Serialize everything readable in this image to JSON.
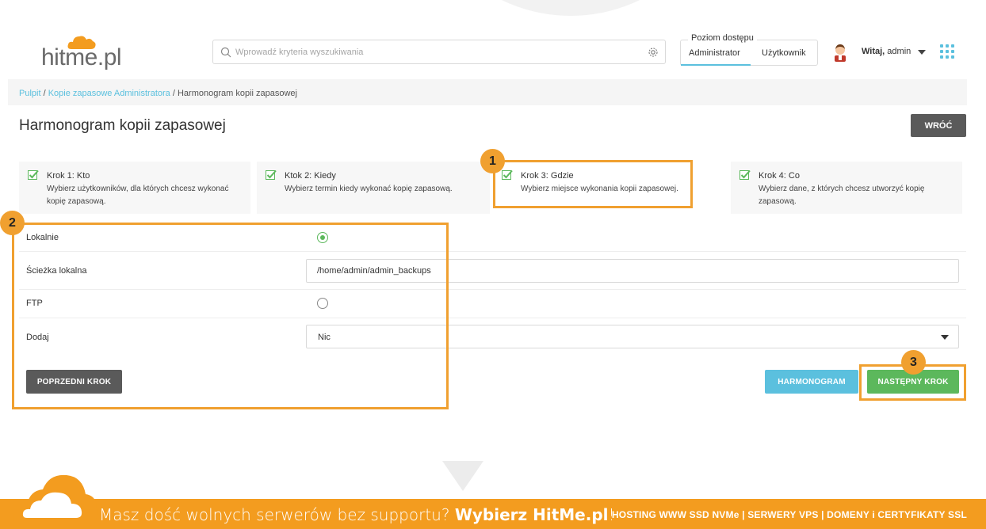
{
  "header": {
    "logo_text": "hitme.pl",
    "search_placeholder": "Wprowadź kryteria wyszukiwania",
    "access": {
      "title": "Poziom dostępu",
      "options": [
        "Administrator",
        "Użytkownik"
      ],
      "selected": "Administrator"
    },
    "greeting_bold": "Witaj,",
    "greeting_user": " admin"
  },
  "breadcrumb": {
    "items": [
      "Pulpit",
      "Kopie zapasowe Administratora",
      "Harmonogram kopii zapasowej"
    ],
    "separator": " / "
  },
  "page": {
    "title": "Harmonogram kopii zapasowej",
    "back_label": "WRÓĆ"
  },
  "steps": [
    {
      "title": "Krok 1: Kto",
      "desc": "Wybierz użytkowników, dla których chcesz wykonać kopię zapasową.",
      "checked": true
    },
    {
      "title": "Ktok 2: Kiedy",
      "desc": "Wybierz termin kiedy wykonać kopię zapasową.",
      "checked": true
    },
    {
      "title": "Krok 3: Gdzie",
      "desc": "Wybierz miejsce wykonania kopii zapasowej.",
      "checked": true
    },
    {
      "title": "Krok 4: Co",
      "desc": "Wybierz dane, z których chcesz utworzyć kopię zapasową.",
      "checked": true
    }
  ],
  "form": {
    "local_label": "Lokalnie",
    "local_selected": true,
    "path_label": "Ścieżka lokalna",
    "path_value": "/home/admin/admin_backups",
    "ftp_label": "FTP",
    "ftp_selected": false,
    "add_label": "Dodaj",
    "add_value": "Nic"
  },
  "buttons": {
    "prev": "POPRZEDNI KROK",
    "schedule": "HARMONOGRAM",
    "next": "NASTĘPNY KROK"
  },
  "annotations": [
    "1",
    "2",
    "3"
  ],
  "footer": {
    "slogan_prefix": "Masz dość wolnych serwerów bez supportu? ",
    "slogan_bold": "Wybierz HitMe.pl",
    "slogan_suffix": "!",
    "links": "HOSTING WWW SSD NVMe | SERWERY VPS | DOMENY i CERTYFIKATY SSL"
  },
  "colors": {
    "accent_blue": "#5bc0de",
    "success_green": "#5cb85c",
    "highlight_orange": "#f0a030",
    "footer_orange": "#f39c1f",
    "dark_button": "#5a5a5a"
  },
  "icons": [
    "cloud-logo-icon",
    "search-icon",
    "gear-icon",
    "avatar-icon",
    "chevron-down-icon",
    "apps-grid-icon",
    "checkbox-checked-icon",
    "radio-icon"
  ]
}
